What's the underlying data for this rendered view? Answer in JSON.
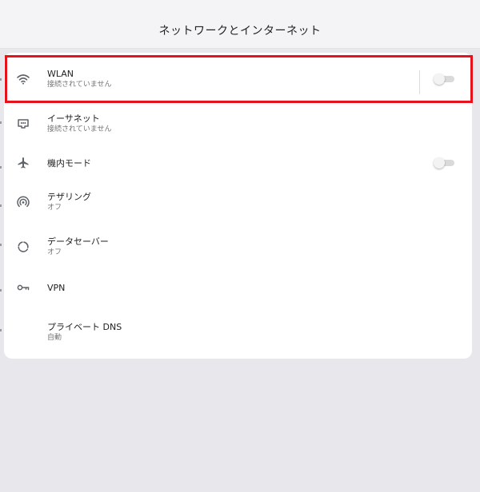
{
  "header": {
    "title": "ネットワークとインターネット"
  },
  "items": [
    {
      "icon": "wifi-icon",
      "title": "WLAN",
      "subtitle": "接続されていません",
      "toggle": false
    },
    {
      "icon": "ethernet-icon",
      "title": "イーサネット",
      "subtitle": "接続されていません"
    },
    {
      "icon": "airplane-icon",
      "title": "機内モード",
      "toggle": false
    },
    {
      "icon": "hotspot-icon",
      "title": "テザリング",
      "subtitle": "オフ"
    },
    {
      "icon": "data-saver-icon",
      "title": "データセーバー",
      "subtitle": "オフ"
    },
    {
      "icon": "vpn-key-icon",
      "title": "VPN"
    },
    {
      "title": "プライベート DNS",
      "subtitle": "自動"
    }
  ],
  "colors": {
    "highlight": "#e8121d",
    "background": "#e8e8ec",
    "card": "#ffffff",
    "icon": "#5f6368"
  }
}
